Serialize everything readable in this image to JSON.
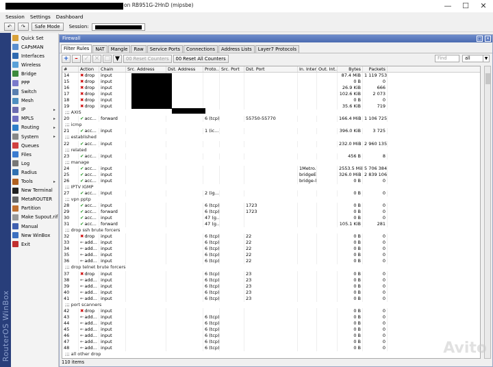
{
  "title": {
    "text": "on RB951G-2HnD (mipsbe)"
  },
  "menu": [
    "Session",
    "Settings",
    "Dashboard"
  ],
  "toolbar": {
    "safe_mode": "Safe Mode",
    "session_label": "Session:"
  },
  "brand": {
    "vertical": "RouterOS WinBox"
  },
  "sidebar": [
    {
      "label": "Quick Set",
      "color": "#d9a23b",
      "sub": false
    },
    {
      "label": "CAPsMAN",
      "color": "#5a8fd0",
      "sub": false
    },
    {
      "label": "Interfaces",
      "color": "#2f6ab0",
      "sub": false
    },
    {
      "label": "Wireless",
      "color": "#5aa0d8",
      "sub": false
    },
    {
      "label": "Bridge",
      "color": "#3d8a3d",
      "sub": false
    },
    {
      "label": "PPP",
      "color": "#7a7acb",
      "sub": false
    },
    {
      "label": "Switch",
      "color": "#5a7fb0",
      "sub": false
    },
    {
      "label": "Mesh",
      "color": "#4f8fc0",
      "sub": false
    },
    {
      "label": "IP",
      "color": "#6b6bb0",
      "sub": true
    },
    {
      "label": "MPLS",
      "color": "#6f6fc0",
      "sub": true
    },
    {
      "label": "Routing",
      "color": "#2f7fc8",
      "sub": true
    },
    {
      "label": "System",
      "color": "#888888",
      "sub": true
    },
    {
      "label": "Queues",
      "color": "#d04040",
      "sub": false
    },
    {
      "label": "Files",
      "color": "#3b7bd0",
      "sub": false
    },
    {
      "label": "Log",
      "color": "#777777",
      "sub": false
    },
    {
      "label": "Radius",
      "color": "#3070b0",
      "sub": false
    },
    {
      "label": "Tools",
      "color": "#b06020",
      "sub": true
    },
    {
      "label": "New Terminal",
      "color": "#222222",
      "sub": false
    },
    {
      "label": "MetaROUTER",
      "color": "#666666",
      "sub": false
    },
    {
      "label": "Partition",
      "color": "#c07030",
      "sub": false
    },
    {
      "label": "Make Supout.rif",
      "color": "#999999",
      "sub": false
    },
    {
      "label": "Manual",
      "color": "#4060b0",
      "sub": false
    },
    {
      "label": "New WinBox",
      "color": "#3b6fc0",
      "sub": false
    },
    {
      "label": "Exit",
      "color": "#c03030",
      "sub": false
    }
  ],
  "firewall": {
    "title": "Firewall",
    "tabs": [
      "Filter Rules",
      "NAT",
      "Mangle",
      "Raw",
      "Service Ports",
      "Connections",
      "Address Lists",
      "Layer7 Protocols"
    ],
    "reset_counters": "Reset Counters",
    "reset_all_counters": "Reset All Counters",
    "find_placeholder": "Find",
    "filter_value": "all",
    "columns": [
      "#",
      "Action",
      "Chain",
      "Src. Address",
      "Dst. Address",
      "Proto...",
      "Src. Port",
      "Dst. Port",
      "In. Inter...",
      "Out. Int...",
      "Bytes",
      "Packets"
    ],
    "status": "110 items"
  },
  "rows": [
    {
      "n": "14",
      "a": "drop",
      "c": "input",
      "p": "",
      "sp": "",
      "dp": "",
      "ii": "",
      "b": "87.4 MiB",
      "pk": "1 119 753"
    },
    {
      "n": "15",
      "a": "drop",
      "c": "input",
      "p": "",
      "sp": "",
      "dp": "",
      "ii": "",
      "b": "0 B",
      "pk": "0"
    },
    {
      "n": "16",
      "a": "drop",
      "c": "input",
      "p": "",
      "sp": "",
      "dp": "",
      "ii": "",
      "b": "26.9 KiB",
      "pk": "666"
    },
    {
      "n": "17",
      "a": "drop",
      "c": "input",
      "p": "",
      "sp": "",
      "dp": "",
      "ii": "",
      "b": "102.6 KiB",
      "pk": "2 073"
    },
    {
      "n": "18",
      "a": "drop",
      "c": "input",
      "p": "",
      "sp": "",
      "dp": "",
      "ii": "",
      "b": "0 B",
      "pk": "0"
    },
    {
      "n": "19",
      "a": "drop",
      "c": "input",
      "p": "",
      "sp": "",
      "dp": "",
      "ii": "",
      "b": "35.6 KiB",
      "pk": "719"
    },
    {
      "cmt": ";;; AXIS"
    },
    {
      "n": "20",
      "a": "acc...",
      "c": "forward",
      "p": "6 (tcp)",
      "sp": "",
      "dp": "55750-55770",
      "ii": "",
      "b": "166.4 MiB",
      "pk": "1 106 725"
    },
    {
      "cmt": ";;; icmp"
    },
    {
      "n": "21",
      "a": "acc...",
      "c": "input",
      "p": "1 (ic...",
      "sp": "",
      "dp": "",
      "ii": "",
      "b": "396.0 KiB",
      "pk": "3 725"
    },
    {
      "cmt": ";;; established"
    },
    {
      "n": "22",
      "a": "acc...",
      "c": "input",
      "p": "",
      "sp": "",
      "dp": "",
      "ii": "",
      "b": "232.0 MiB",
      "pk": "2 960 135"
    },
    {
      "cmt": ";;; related"
    },
    {
      "n": "23",
      "a": "acc...",
      "c": "input",
      "p": "",
      "sp": "",
      "dp": "",
      "ii": "",
      "b": "456 B",
      "pk": "8"
    },
    {
      "cmt": ";;; manage"
    },
    {
      "n": "24",
      "a": "acc...",
      "c": "input",
      "p": "",
      "sp": "",
      "dp": "",
      "ii": "1Metro...",
      "b": "2553.5 MiB",
      "pk": "5 706 384"
    },
    {
      "n": "25",
      "a": "acc...",
      "c": "input",
      "p": "",
      "sp": "",
      "dp": "",
      "ii": "bridgeE...",
      "b": "326.0 MiB",
      "pk": "2 839 106"
    },
    {
      "n": "26",
      "a": "acc...",
      "c": "input",
      "p": "",
      "sp": "",
      "dp": "",
      "ii": "bridge-l...",
      "b": "0 B",
      "pk": "0"
    },
    {
      "cmt": ";;; IPTV IGMP"
    },
    {
      "n": "27",
      "a": "acc...",
      "c": "input",
      "p": "2 (ig...",
      "sp": "",
      "dp": "",
      "ii": "",
      "b": "0 B",
      "pk": "0"
    },
    {
      "cmt": ";;; vpn pptp"
    },
    {
      "n": "28",
      "a": "acc...",
      "c": "input",
      "p": "6 (tcp)",
      "sp": "",
      "dp": "1723",
      "ii": "",
      "b": "0 B",
      "pk": "0"
    },
    {
      "n": "29",
      "a": "acc...",
      "c": "forward",
      "p": "6 (tcp)",
      "sp": "",
      "dp": "1723",
      "ii": "",
      "b": "0 B",
      "pk": "0"
    },
    {
      "n": "30",
      "a": "acc...",
      "c": "input",
      "p": "47 (g...",
      "sp": "",
      "dp": "",
      "ii": "",
      "b": "0 B",
      "pk": "0"
    },
    {
      "n": "31",
      "a": "acc...",
      "c": "forward",
      "p": "47 (g...",
      "sp": "",
      "dp": "",
      "ii": "",
      "b": "105.1 KiB",
      "pk": "281"
    },
    {
      "cmt": ";;; drop ssh brute forcers"
    },
    {
      "n": "32",
      "a": "drop",
      "c": "input",
      "p": "6 (tcp)",
      "sp": "",
      "dp": "22",
      "ii": "",
      "b": "0 B",
      "pk": "0"
    },
    {
      "n": "33",
      "a": "add...",
      "c": "input",
      "p": "6 (tcp)",
      "sp": "",
      "dp": "22",
      "ii": "",
      "b": "0 B",
      "pk": "0"
    },
    {
      "n": "34",
      "a": "add...",
      "c": "input",
      "p": "6 (tcp)",
      "sp": "",
      "dp": "22",
      "ii": "",
      "b": "0 B",
      "pk": "0"
    },
    {
      "n": "35",
      "a": "add...",
      "c": "input",
      "p": "6 (tcp)",
      "sp": "",
      "dp": "22",
      "ii": "",
      "b": "0 B",
      "pk": "0"
    },
    {
      "n": "36",
      "a": "add...",
      "c": "input",
      "p": "6 (tcp)",
      "sp": "",
      "dp": "22",
      "ii": "",
      "b": "0 B",
      "pk": "0"
    },
    {
      "cmt": ";;; drop telnet brute forcers"
    },
    {
      "n": "37",
      "a": "drop",
      "c": "input",
      "p": "6 (tcp)",
      "sp": "",
      "dp": "23",
      "ii": "",
      "b": "0 B",
      "pk": "0"
    },
    {
      "n": "38",
      "a": "add...",
      "c": "input",
      "p": "6 (tcp)",
      "sp": "",
      "dp": "23",
      "ii": "",
      "b": "0 B",
      "pk": "0"
    },
    {
      "n": "39",
      "a": "add...",
      "c": "input",
      "p": "6 (tcp)",
      "sp": "",
      "dp": "23",
      "ii": "",
      "b": "0 B",
      "pk": "0"
    },
    {
      "n": "40",
      "a": "add...",
      "c": "input",
      "p": "6 (tcp)",
      "sp": "",
      "dp": "23",
      "ii": "",
      "b": "0 B",
      "pk": "0"
    },
    {
      "n": "41",
      "a": "add...",
      "c": "input",
      "p": "6 (tcp)",
      "sp": "",
      "dp": "23",
      "ii": "",
      "b": "0 B",
      "pk": "0"
    },
    {
      "cmt": ";;; port scanners"
    },
    {
      "n": "42",
      "a": "drop",
      "c": "input",
      "p": "",
      "sp": "",
      "dp": "",
      "ii": "",
      "b": "0 B",
      "pk": "0"
    },
    {
      "n": "43",
      "a": "add...",
      "c": "input",
      "p": "6 (tcp)",
      "sp": "",
      "dp": "",
      "ii": "",
      "b": "0 B",
      "pk": "0"
    },
    {
      "n": "44",
      "a": "add...",
      "c": "input",
      "p": "6 (tcp)",
      "sp": "",
      "dp": "",
      "ii": "",
      "b": "0 B",
      "pk": "0"
    },
    {
      "n": "45",
      "a": "add...",
      "c": "input",
      "p": "6 (tcp)",
      "sp": "",
      "dp": "",
      "ii": "",
      "b": "0 B",
      "pk": "0"
    },
    {
      "n": "46",
      "a": "add...",
      "c": "input",
      "p": "6 (tcp)",
      "sp": "",
      "dp": "",
      "ii": "",
      "b": "0 B",
      "pk": "0"
    },
    {
      "n": "47",
      "a": "add...",
      "c": "input",
      "p": "6 (tcp)",
      "sp": "",
      "dp": "",
      "ii": "",
      "b": "0 B",
      "pk": "0"
    },
    {
      "n": "48",
      "a": "add...",
      "c": "input",
      "p": "6 (tcp)",
      "sp": "",
      "dp": "",
      "ii": "",
      "b": "0 B",
      "pk": "0"
    },
    {
      "cmt": ";;; all other drop"
    }
  ]
}
